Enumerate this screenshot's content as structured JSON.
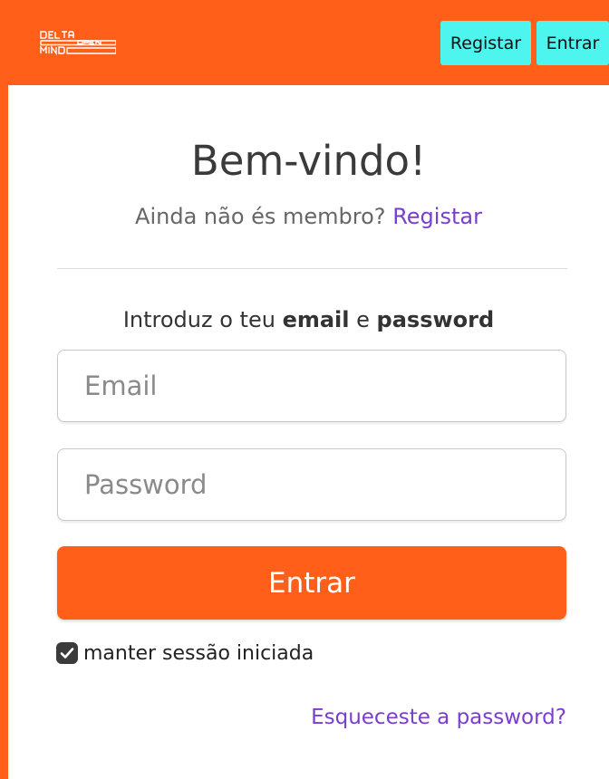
{
  "header": {
    "logo_text": [
      "DELTA",
      "OPEN",
      "MIND"
    ],
    "register_label": "Registar",
    "login_label": "Entrar"
  },
  "main": {
    "title": "Bem-vindo!",
    "subtitle_text": "Ainda não és membro?",
    "subtitle_link": "Registar",
    "prompt_before": "Introduz o teu",
    "prompt_email": "email",
    "prompt_and": "e",
    "prompt_password": "password",
    "email_placeholder": "Email",
    "password_placeholder": "Password",
    "submit_label": "Entrar",
    "remember_label": "manter sessão iniciada",
    "remember_checked": true,
    "forgot_label": "Esqueceste a password?"
  },
  "colors": {
    "brand": "#ff5f19",
    "nav_button": "#4df5ee",
    "link": "#7a3dd1"
  },
  "icons": [
    "logo",
    "checkbox-check-icon"
  ]
}
